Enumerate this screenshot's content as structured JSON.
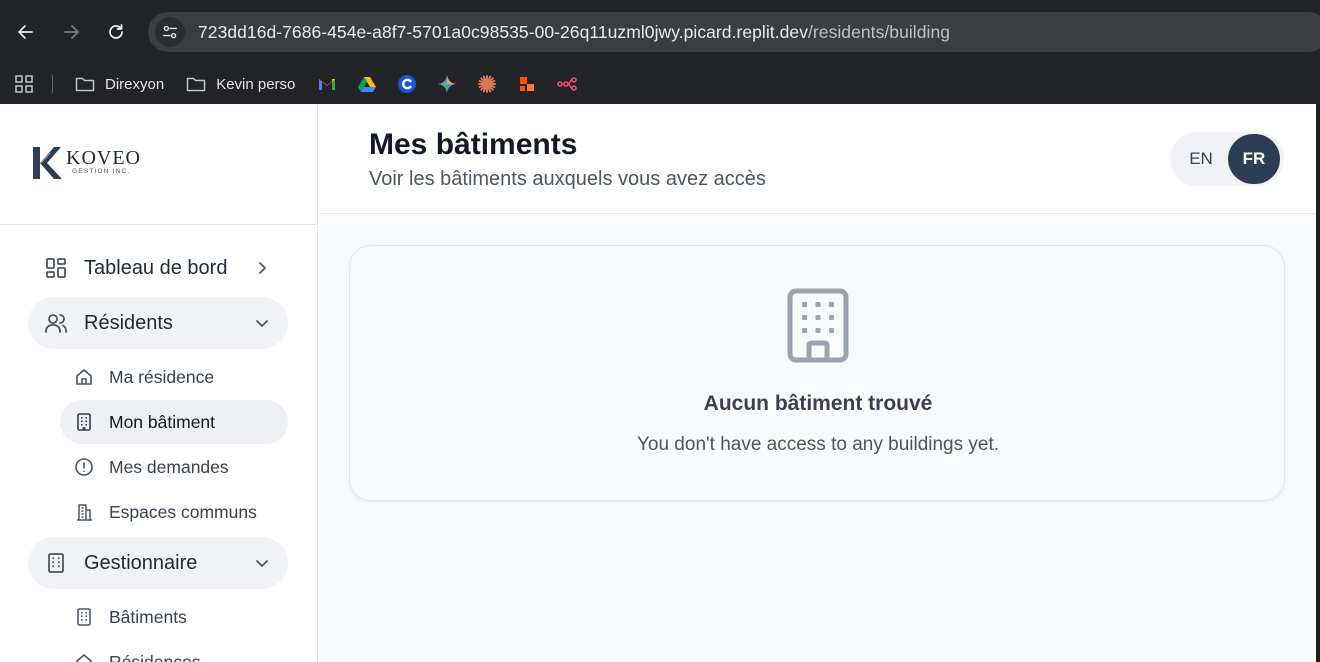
{
  "browser": {
    "url_host": "723dd16d-7686-454e-a8f7-5701a0c98535-00-26q11uzml0jwy.picard.replit.dev",
    "url_path": "/residents/building",
    "bookmarks": [
      {
        "type": "folder",
        "label": "Direxyon"
      },
      {
        "type": "folder",
        "label": "Kevin perso"
      }
    ],
    "bookmark_icons": [
      "gmail-icon",
      "google-drive-icon",
      "c-app-icon",
      "gemini-icon",
      "claude-icon",
      "zapier-icon",
      "n8n-icon"
    ]
  },
  "logo": {
    "word": "KOVEO",
    "subtitle": "GESTION INC."
  },
  "sidebar": {
    "items": [
      {
        "label": "Tableau de bord",
        "icon": "dashboard-icon",
        "chevron": "right"
      },
      {
        "label": "Résidents",
        "icon": "users-icon",
        "chevron": "down"
      },
      {
        "label": "Gestionnaire",
        "icon": "building-icon",
        "chevron": "down"
      }
    ],
    "residents_sub": [
      {
        "label": "Ma résidence",
        "icon": "home-icon"
      },
      {
        "label": "Mon bâtiment",
        "icon": "building-icon"
      },
      {
        "label": "Mes demandes",
        "icon": "alert-circle-icon"
      },
      {
        "label": "Espaces communs",
        "icon": "building-2-icon"
      }
    ],
    "manager_sub": [
      {
        "label": "Bâtiments",
        "icon": "building-icon"
      },
      {
        "label": "Résidences",
        "icon": "home-icon"
      }
    ]
  },
  "header": {
    "title": "Mes bâtiments",
    "subtitle": "Voir les bâtiments auxquels vous avez accès",
    "lang_en": "EN",
    "lang_fr": "FR",
    "lang_selected": "FR"
  },
  "empty_state": {
    "icon": "building-icon",
    "title": "Aucun bâtiment trouvé",
    "message": "You don't have access to any buildings yet."
  },
  "colors": {
    "accent_dark": "#2d3e54",
    "active_bg": "#f1f3f6",
    "page_bg": "#f8fafc"
  }
}
